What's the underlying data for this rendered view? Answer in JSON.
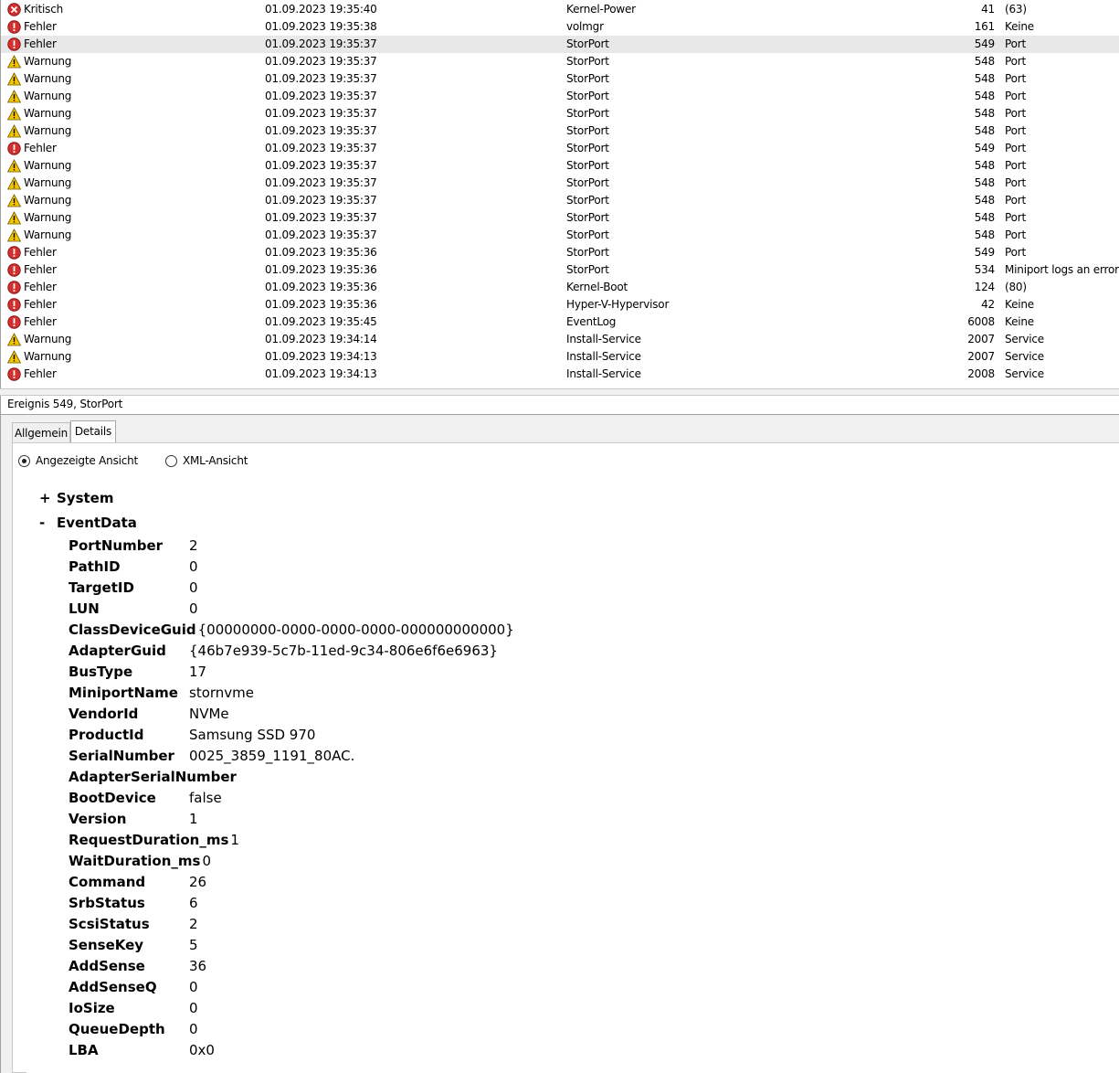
{
  "events": [
    {
      "level": "Kritisch",
      "icon": "critical-icon",
      "date": "01.09.2023 19:35:40",
      "source": "Kernel-Power",
      "id": "41",
      "category": "(63)"
    },
    {
      "level": "Fehler",
      "icon": "error-icon",
      "date": "01.09.2023 19:35:38",
      "source": "volmgr",
      "id": "161",
      "category": "Keine"
    },
    {
      "level": "Fehler",
      "icon": "error-icon",
      "date": "01.09.2023 19:35:37",
      "source": "StorPort",
      "id": "549",
      "category": "Port",
      "selected": true
    },
    {
      "level": "Warnung",
      "icon": "warning-icon",
      "date": "01.09.2023 19:35:37",
      "source": "StorPort",
      "id": "548",
      "category": "Port"
    },
    {
      "level": "Warnung",
      "icon": "warning-icon",
      "date": "01.09.2023 19:35:37",
      "source": "StorPort",
      "id": "548",
      "category": "Port"
    },
    {
      "level": "Warnung",
      "icon": "warning-icon",
      "date": "01.09.2023 19:35:37",
      "source": "StorPort",
      "id": "548",
      "category": "Port"
    },
    {
      "level": "Warnung",
      "icon": "warning-icon",
      "date": "01.09.2023 19:35:37",
      "source": "StorPort",
      "id": "548",
      "category": "Port"
    },
    {
      "level": "Warnung",
      "icon": "warning-icon",
      "date": "01.09.2023 19:35:37",
      "source": "StorPort",
      "id": "548",
      "category": "Port"
    },
    {
      "level": "Fehler",
      "icon": "error-icon",
      "date": "01.09.2023 19:35:37",
      "source": "StorPort",
      "id": "549",
      "category": "Port"
    },
    {
      "level": "Warnung",
      "icon": "warning-icon",
      "date": "01.09.2023 19:35:37",
      "source": "StorPort",
      "id": "548",
      "category": "Port"
    },
    {
      "level": "Warnung",
      "icon": "warning-icon",
      "date": "01.09.2023 19:35:37",
      "source": "StorPort",
      "id": "548",
      "category": "Port"
    },
    {
      "level": "Warnung",
      "icon": "warning-icon",
      "date": "01.09.2023 19:35:37",
      "source": "StorPort",
      "id": "548",
      "category": "Port"
    },
    {
      "level": "Warnung",
      "icon": "warning-icon",
      "date": "01.09.2023 19:35:37",
      "source": "StorPort",
      "id": "548",
      "category": "Port"
    },
    {
      "level": "Warnung",
      "icon": "warning-icon",
      "date": "01.09.2023 19:35:37",
      "source": "StorPort",
      "id": "548",
      "category": "Port"
    },
    {
      "level": "Fehler",
      "icon": "error-icon",
      "date": "01.09.2023 19:35:36",
      "source": "StorPort",
      "id": "549",
      "category": "Port"
    },
    {
      "level": "Fehler",
      "icon": "error-icon",
      "date": "01.09.2023 19:35:36",
      "source": "StorPort",
      "id": "534",
      "category": "Miniport logs an error."
    },
    {
      "level": "Fehler",
      "icon": "error-icon",
      "date": "01.09.2023 19:35:36",
      "source": "Kernel-Boot",
      "id": "124",
      "category": "(80)"
    },
    {
      "level": "Fehler",
      "icon": "error-icon",
      "date": "01.09.2023 19:35:36",
      "source": "Hyper-V-Hypervisor",
      "id": "42",
      "category": "Keine"
    },
    {
      "level": "Fehler",
      "icon": "error-icon",
      "date": "01.09.2023 19:35:45",
      "source": "EventLog",
      "id": "6008",
      "category": "Keine"
    },
    {
      "level": "Warnung",
      "icon": "warning-icon",
      "date": "01.09.2023 19:34:14",
      "source": "Install-Service",
      "id": "2007",
      "category": "Service"
    },
    {
      "level": "Warnung",
      "icon": "warning-icon",
      "date": "01.09.2023 19:34:13",
      "source": "Install-Service",
      "id": "2007",
      "category": "Service"
    },
    {
      "level": "Fehler",
      "icon": "error-icon",
      "date": "01.09.2023 19:34:13",
      "source": "Install-Service",
      "id": "2008",
      "category": "Service"
    }
  ],
  "detail": {
    "header": "Ereignis 549, StorPort",
    "tabs": [
      "Allgemein",
      "Details"
    ],
    "active_tab": "Details",
    "view_options": [
      "Angezeigte Ansicht",
      "XML-Ansicht"
    ],
    "selected_view": "Angezeigte Ansicht",
    "system_node": {
      "toggle": "+",
      "label": "System"
    },
    "eventdata_node": {
      "toggle": "-",
      "label": "EventData"
    },
    "event_data": [
      {
        "key": "PortNumber",
        "value": "2"
      },
      {
        "key": "PathID",
        "value": "0"
      },
      {
        "key": "TargetID",
        "value": "0"
      },
      {
        "key": "LUN",
        "value": "0"
      },
      {
        "key": "ClassDeviceGuid",
        "value": "{00000000-0000-0000-0000-000000000000}"
      },
      {
        "key": "AdapterGuid",
        "value": "{46b7e939-5c7b-11ed-9c34-806e6f6e6963}"
      },
      {
        "key": "BusType",
        "value": "17"
      },
      {
        "key": "MiniportName",
        "value": "stornvme"
      },
      {
        "key": "VendorId",
        "value": "NVMe"
      },
      {
        "key": "ProductId",
        "value": "Samsung SSD 970"
      },
      {
        "key": "SerialNumber",
        "value": "0025_3859_1191_80AC."
      },
      {
        "key": "AdapterSerialNumber",
        "value": ""
      },
      {
        "key": "BootDevice",
        "value": "false"
      },
      {
        "key": "Version",
        "value": "1"
      },
      {
        "key": "RequestDuration_ms",
        "value": "1"
      },
      {
        "key": "WaitDuration_ms",
        "value": "0"
      },
      {
        "key": "Command",
        "value": "26"
      },
      {
        "key": "SrbStatus",
        "value": "6"
      },
      {
        "key": "ScsiStatus",
        "value": "2"
      },
      {
        "key": "SenseKey",
        "value": "5"
      },
      {
        "key": "AddSense",
        "value": "36"
      },
      {
        "key": "AddSenseQ",
        "value": "0"
      },
      {
        "key": "IoSize",
        "value": "0"
      },
      {
        "key": "QueueDepth",
        "value": "0"
      },
      {
        "key": "LBA",
        "value": "0x0"
      }
    ]
  },
  "colors": {
    "error": "#d32f2f",
    "critical": "#d32f2f",
    "warning": "#f5c400",
    "selected_row": "#e8e8e8"
  }
}
